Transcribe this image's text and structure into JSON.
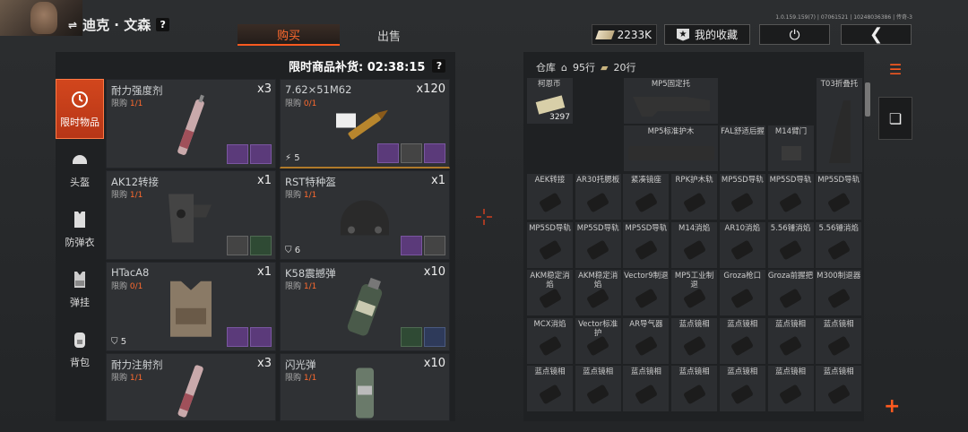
{
  "player": {
    "name": "迪克 · 文森",
    "help": "?"
  },
  "tabs": [
    {
      "label": "购买"
    },
    {
      "label": "出售"
    }
  ],
  "version": "1.0.159.159(7) | 07061521 | 10248036386 | 传奇-3",
  "currency": {
    "amount": "2233K",
    "icon": "ticket-icon"
  },
  "favorites": {
    "label": "我的收藏"
  },
  "restock": {
    "label": "限时商品补货: 02:38:15",
    "help": "?"
  },
  "categories": [
    {
      "label": "限时物品",
      "icon": "clock-icon"
    },
    {
      "label": "头盔",
      "icon": "helmet-icon"
    },
    {
      "label": "防弹衣",
      "icon": "vest-icon"
    },
    {
      "label": "弹挂",
      "icon": "rig-icon"
    },
    {
      "label": "背包",
      "icon": "backpack-icon"
    }
  ],
  "shop_items": [
    {
      "name": "耐力强度剂",
      "limit_label": "限购",
      "limit": "1/1",
      "qty": "x3"
    },
    {
      "name": "7.62×51M62",
      "limit_label": "限购",
      "limit": "0/1",
      "qty": "x120",
      "stat": "5"
    },
    {
      "name": "AK12转接",
      "limit_label": "限购",
      "limit": "1/1",
      "qty": "x1"
    },
    {
      "name": "RST特种盔",
      "limit_label": "限购",
      "limit": "1/1",
      "qty": "x1",
      "stat": "6"
    },
    {
      "name": "HTacA8",
      "limit_label": "限购",
      "limit": "0/1",
      "qty": "x1",
      "stat": "5"
    },
    {
      "name": "K58震撼弹",
      "limit_label": "限购",
      "limit": "1/1",
      "qty": "x10"
    },
    {
      "name": "耐力注射剂",
      "limit_label": "限购",
      "limit": "1/1",
      "qty": "x3"
    },
    {
      "name": "闪光弹",
      "limit_label": "限购",
      "limit": "1/1",
      "qty": "x10"
    }
  ],
  "warehouse": {
    "title": "仓库",
    "rows": "95行",
    "rows2": "20行"
  },
  "warehouse_items": [
    {
      "name": "柯恩币",
      "count": "3297"
    },
    {
      "name": "MP5固定托"
    },
    {
      "name": "T03折叠托"
    },
    {
      "name": "MP5标准护木"
    },
    {
      "name": "FAL舒适后握"
    },
    {
      "name": "M14臂门"
    },
    {
      "name": "AEK转接"
    },
    {
      "name": "AR30托腮板"
    },
    {
      "name": "紧凑镜座"
    },
    {
      "name": "RPK护木轨"
    },
    {
      "name": "MP5SD导轨"
    },
    {
      "name": "MP5SD导轨"
    },
    {
      "name": "MP5SD导轨"
    },
    {
      "name": "MP5SD导轨"
    },
    {
      "name": "MP5SD导轨"
    },
    {
      "name": "MP5SD导轨"
    },
    {
      "name": "M14消焰"
    },
    {
      "name": "AR10消焰"
    },
    {
      "name": "5.56锤消焰"
    },
    {
      "name": "5.56锤消焰"
    },
    {
      "name": "AKM稳定消焰"
    },
    {
      "name": "AKM稳定消焰"
    },
    {
      "name": "Vector9制退"
    },
    {
      "name": "MP5工业制退"
    },
    {
      "name": "Groza枪口"
    },
    {
      "name": "Groza前握把"
    },
    {
      "name": "M300制退器"
    },
    {
      "name": "MCX消焰"
    },
    {
      "name": "Vector标准护"
    },
    {
      "name": "AR导气器"
    },
    {
      "name": "蓝点镜相"
    },
    {
      "name": "蓝点镜相"
    },
    {
      "name": "蓝点镜相"
    },
    {
      "name": "蓝点镜相"
    },
    {
      "name": "蓝点镜相"
    },
    {
      "name": "蓝点镜相"
    },
    {
      "name": "蓝点镜相"
    },
    {
      "name": "蓝点镜相"
    },
    {
      "name": "蓝点镜相"
    },
    {
      "name": "蓝点镜相"
    },
    {
      "name": "蓝点镜相"
    }
  ],
  "colors": {
    "accent": "#ff5a1f",
    "purple": "#5b3a7a"
  }
}
